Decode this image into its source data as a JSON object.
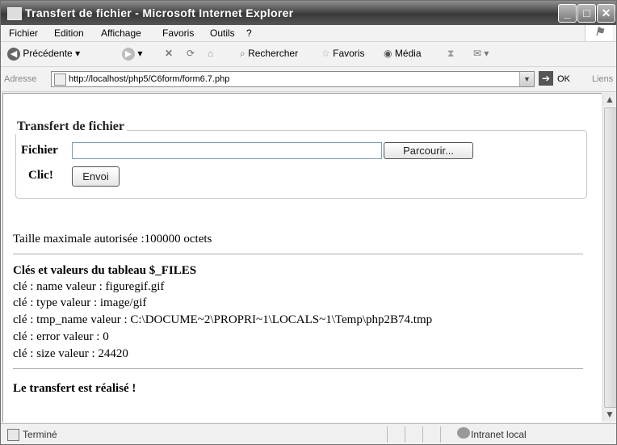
{
  "window": {
    "title": "Transfert de fichier - Microsoft Internet Explorer"
  },
  "menu": [
    "Fichier",
    "Edition",
    "Affichage",
    "Favoris",
    "Outils",
    "?"
  ],
  "toolbar": {
    "back": "Précédente",
    "search": "Rechercher",
    "favorites": "Favoris",
    "media": "Média"
  },
  "address": {
    "label": "Adresse",
    "url": "http://localhost/php5/C6form/form6.7.php",
    "go": "OK",
    "links": "Liens"
  },
  "form": {
    "legend": "Transfert de fichier",
    "file_label": "Fichier",
    "file_value": "",
    "browse_label": "Parcourir...",
    "submit_prompt": "Clic!",
    "submit_label": "Envoi"
  },
  "content": {
    "max_size": "Taille maximale autorisée :100000 octets",
    "files_heading": "Clés et valeurs du tableau $_FILES",
    "files_lines": [
      "clé : name valeur : figuregif.gif",
      "clé : type valeur : image/gif",
      "clé : tmp_name valeur : C:\\DOCUME~2\\PROPRI~1\\LOCALS~1\\Temp\\php2B74.tmp",
      "clé : error valeur : 0",
      "clé : size valeur : 24420"
    ],
    "result": "Le transfert est réalisé !"
  },
  "status": {
    "text": "Terminé",
    "zone": "Intranet local"
  }
}
